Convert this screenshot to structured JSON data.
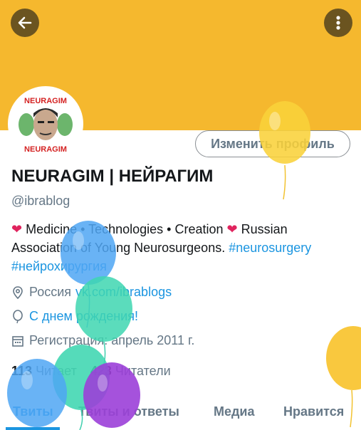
{
  "header": {
    "background": "#f5b82e"
  },
  "avatar": {
    "text_top": "NEURAGIM",
    "text_bottom": "NEURAGIM"
  },
  "edit_profile_label": "Изменить профиль",
  "profile": {
    "name": "NEURAGIM | НЕЙРАГИМ",
    "handle": "@ibrablog",
    "bio": {
      "part1": " Medicine • Technologies • Creation ",
      "part2": " Russian Association of Young Neurosurgeons. ",
      "tag1": "#neurosurgery",
      "tag2": "#нейрохирургия"
    },
    "location": "Россия",
    "website": "vk.com/ibrablogs",
    "birthday": "С днем рождения!",
    "joined": "Регистрация: апрель 2011 г."
  },
  "counts": {
    "following_value": "113",
    "following_label": "Читает",
    "followers_value": "423",
    "followers_label": "Читатели"
  },
  "tabs": [
    "Твиты",
    "Твиты и ответы",
    "Медиа",
    "Нравится"
  ],
  "colors": {
    "accent": "#1b95e0",
    "heart": "#e0245e",
    "muted": "#657786"
  }
}
